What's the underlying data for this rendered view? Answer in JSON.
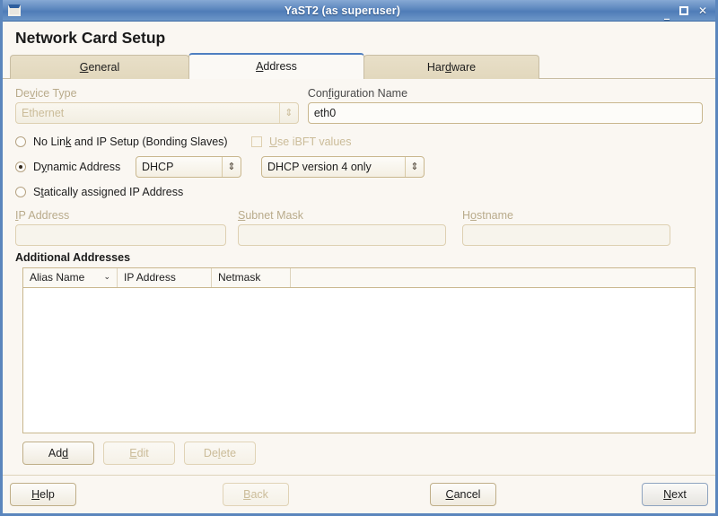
{
  "window": {
    "title": "YaST2 (as superuser)",
    "icon": "window-icon",
    "controls": {
      "minimize": "_",
      "maximize": "□",
      "close": "✕"
    }
  },
  "heading": "Network Card Setup",
  "tabs": [
    {
      "label": "General",
      "mnemonic": "G",
      "active": false
    },
    {
      "label": "Address",
      "mnemonic": "A",
      "active": true
    },
    {
      "label": "Hardware",
      "mnemonic": "d",
      "active": false
    }
  ],
  "form": {
    "device_type": {
      "label": "Device Type",
      "value": "Ethernet",
      "enabled": false,
      "arrow": "⇕"
    },
    "configuration_name": {
      "label": "Configuration Name",
      "value": "eth0",
      "enabled": true
    },
    "no_link": {
      "label_pre": "No Lin",
      "mnemonic": "k",
      "label_post": " and IP Setup (Bonding Slaves)",
      "selected": false
    },
    "use_ibft": {
      "label_pre": "",
      "mnemonic": "U",
      "label_post": "se iBFT values",
      "checked": false,
      "enabled": false
    },
    "dynamic_address": {
      "label_pre": "D",
      "mnemonic": "y",
      "label_post": "namic Address",
      "selected": true
    },
    "dhcp_mode": {
      "value": "DHCP",
      "arrow": "⇕"
    },
    "dhcp_version": {
      "value": "DHCP version 4 only",
      "arrow": "⇕"
    },
    "static_address": {
      "label_pre": "S",
      "mnemonic": "t",
      "label_post": "atically assigned IP Address",
      "selected": false
    },
    "ip_address": {
      "label": "IP Address",
      "mnemonic": "I",
      "value": "",
      "enabled": false
    },
    "subnet_mask": {
      "label": "Subnet Mask",
      "mnemonic": "S",
      "value": "",
      "enabled": false
    },
    "hostname": {
      "label": "Hostname",
      "mnemonic": "o",
      "value": "",
      "enabled": false
    }
  },
  "additional_addresses": {
    "title": "Additional Addresses",
    "columns": [
      "Alias Name",
      "IP Address",
      "Netmask"
    ],
    "sort_column": "Alias Name",
    "sort_caret": "⌄",
    "rows": [],
    "buttons": [
      {
        "label": "Add",
        "mnemonic": "d",
        "enabled": true
      },
      {
        "label": "Edit",
        "mnemonic": "E",
        "enabled": false
      },
      {
        "label": "Delete",
        "mnemonic": "l",
        "enabled": false
      }
    ]
  },
  "footer": {
    "help": {
      "label": "Help",
      "mnemonic": "H",
      "enabled": true
    },
    "back": {
      "label": "Back",
      "mnemonic": "B",
      "enabled": false
    },
    "cancel": {
      "label": "Cancel",
      "mnemonic": "C",
      "enabled": true
    },
    "next": {
      "label": "Next",
      "mnemonic": "N",
      "enabled": true,
      "default": true
    }
  },
  "colors": {
    "titlebar": "#5b86bd",
    "background": "#faf7f2",
    "tab_inactive": "#e2d8bd",
    "border": "#c9b78e",
    "accent": "#4e7fc1"
  }
}
